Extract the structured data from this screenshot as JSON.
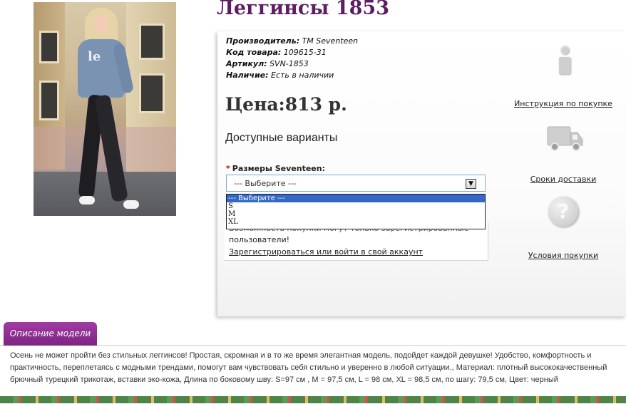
{
  "product": {
    "title": "Леггинсы 1853",
    "meta": [
      {
        "label": "Производитель:",
        "value": "TM Seventeen"
      },
      {
        "label": "Код товара:",
        "value": "109615-31"
      },
      {
        "label": "Артикул:",
        "value": "SVN-1853"
      },
      {
        "label": "Наличие:",
        "value": "Есть в наличии"
      }
    ],
    "price": "Цена:813 р.",
    "variants_heading": "Доступные варианты",
    "photo_text": "le"
  },
  "size_select": {
    "required_mark": "*",
    "label": "Размеры Seventeen:",
    "value": "--- Выберите ---",
    "arrow": "▼",
    "options": [
      "--- Выберите ---",
      "S",
      "M",
      "XL"
    ],
    "selected_index": 0
  },
  "notice": {
    "line1": "Возможность покупки могут только зарегистрированные",
    "line2": "пользователи!",
    "link": "Зарегистрироваться или войти в свой аккаунт"
  },
  "sidebar": {
    "items": [
      {
        "label": "Инструкция по покупке",
        "icon": "info-icon"
      },
      {
        "label": "Сроки доставки",
        "icon": "truck-icon"
      },
      {
        "label": "Условия покупки",
        "icon": "question-icon"
      }
    ],
    "question_glyph": "?"
  },
  "description": {
    "tab_label": "Описание модели",
    "text": "Осень не может пройти без стильных леггинсов! Простая, скромная и в то же время элегантная модель, подойдет каждой девушке! Удобство, комфортность и практичность, переплетаясь с модными трендами, помогут вам чувствовать себя стильно и уверенно в любой ситуации., Материал: плотный высококачественный брючный турецкий трикотаж, вставки эко-кожа, Длина по боковому шву: S=97 см , M = 97,5 см, L = 98 см, XL = 98,5 см, по шагу: 79,5 см, Цвет: черный"
  },
  "colors": {
    "title": "#5d1d63",
    "tab": "#8e2d91",
    "selected_option": "#3368c8"
  }
}
